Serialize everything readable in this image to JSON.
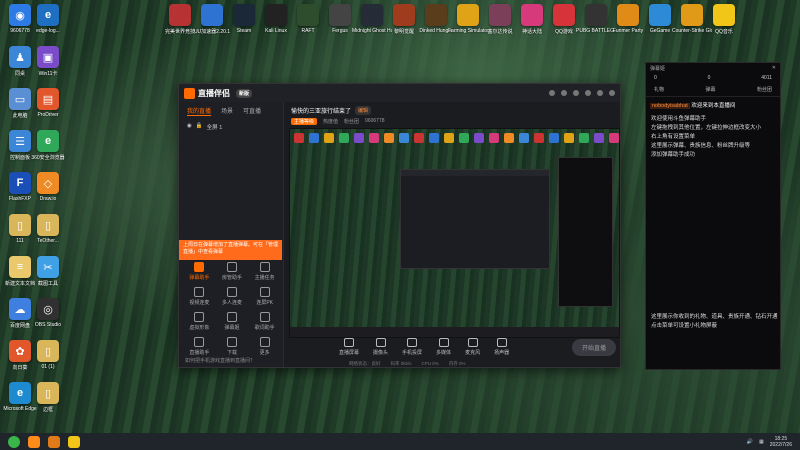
{
  "desktop_icons_left": [
    {
      "label": "9606778",
      "color": "#2c7be5",
      "glyph": "◉"
    },
    {
      "label": "edge-log...",
      "color": "#1e6fc1",
      "glyph": "e"
    },
    {
      "label": "同桌",
      "color": "#3b86d6",
      "glyph": "♟"
    },
    {
      "label": "Win11卡",
      "color": "#7a4cc9",
      "glyph": "▣"
    },
    {
      "label": "此电脑",
      "color": "#5a8fd4",
      "glyph": "▭"
    },
    {
      "label": "ProDriver",
      "color": "#e2562b",
      "glyph": "▤"
    },
    {
      "label": "控制面板",
      "color": "#3b86d6",
      "glyph": "☰"
    },
    {
      "label": "360安全浏览器",
      "color": "#2fa85a",
      "glyph": "e"
    },
    {
      "label": "FlashFXP",
      "color": "#1a4fb8",
      "glyph": "F"
    },
    {
      "label": "Draw.io",
      "color": "#f08a24",
      "glyph": "◇"
    },
    {
      "label": "111",
      "color": "#d9b65a",
      "glyph": "▯"
    },
    {
      "label": "TeOther...",
      "color": "#d9b65a",
      "glyph": "▯"
    },
    {
      "label": "新建文本文档",
      "color": "#e9c96b",
      "glyph": "≡"
    },
    {
      "label": "截图工具",
      "color": "#3fa0e6",
      "glyph": "✂"
    },
    {
      "label": "百度网盘",
      "color": "#3e7fe0",
      "glyph": "☁"
    },
    {
      "label": "OBS Studio",
      "color": "#303030",
      "glyph": "◎"
    },
    {
      "label": "向日葵",
      "color": "#e2562b",
      "glyph": "✿"
    },
    {
      "label": "01 (1)",
      "color": "#d9b65a",
      "glyph": "▯"
    },
    {
      "label": "Microsoft Edge",
      "color": "#1e8bd1",
      "glyph": "e"
    },
    {
      "label": "边框",
      "color": "#d9b65a",
      "glyph": "▯"
    }
  ],
  "desktop_icons_top": [
    {
      "label": "完美世界竞技",
      "color": "#b73333"
    },
    {
      "label": "UU加速器2.20.1",
      "color": "#2e72d2"
    },
    {
      "label": "Steam",
      "color": "#1b2838"
    },
    {
      "label": "Kali Linux",
      "color": "#222"
    },
    {
      "label": "RAFT",
      "color": "#2d4d2d"
    },
    {
      "label": "Fergus",
      "color": "#444"
    },
    {
      "label": "Midnight Ghost Hunt",
      "color": "#262b38"
    },
    {
      "label": "黎明觉醒",
      "color": "#a03c1e"
    },
    {
      "label": "Dinked Hunger",
      "color": "#5a3d1b"
    },
    {
      "label": "Farming Simulator",
      "color": "#e0a317"
    },
    {
      "label": "塞尔达传说",
      "color": "#7b3f5a"
    },
    {
      "label": "神话大陆",
      "color": "#d63a7a"
    },
    {
      "label": "QQ游戏",
      "color": "#d6343a"
    },
    {
      "label": "PUBG BATTLEG...",
      "color": "#333"
    },
    {
      "label": "Funmer Party",
      "color": "#e08a17"
    },
    {
      "label": "GeGame",
      "color": "#2d8ad6"
    },
    {
      "label": "Counter-Strike Global Of...",
      "color": "#e09a17"
    },
    {
      "label": "QQ音乐",
      "color": "#f2c618"
    }
  ],
  "app": {
    "name": "直播伴侣",
    "version": "新版",
    "left_tabs": [
      "我的直播",
      "场景",
      "可直播"
    ],
    "scene_label": "全屏 1",
    "notice": "上周日在弹幕增加了直播弹幕。可在「管理直播」中查看弹幕",
    "tools": [
      {
        "label": "弹幕助手",
        "hot": true
      },
      {
        "label": "房管助手",
        "hot": false
      },
      {
        "label": "主播任务",
        "hot": false
      },
      {
        "label": "视频连麦",
        "hot": false
      },
      {
        "label": "多人连麦",
        "hot": false
      },
      {
        "label": "连屏PK",
        "hot": false
      },
      {
        "label": "虚拟形象",
        "hot": false
      },
      {
        "label": "弹幕姬",
        "hot": false
      },
      {
        "label": "歌词助手",
        "hot": false
      },
      {
        "label": "直播助手",
        "hot": false
      },
      {
        "label": "下载",
        "hot": false
      },
      {
        "label": "更多",
        "hot": false
      }
    ],
    "left_footer": "如何把手机游戏直播到直播间？",
    "stream_title": "愉快的三亚旅行结束了",
    "edit_label": "编辑",
    "meta_tag": "主播等级",
    "meta": [
      "热度值",
      "粉丝团",
      "9606778"
    ],
    "controls": [
      "直播屏幕",
      "摄像头",
      "手机投屏",
      "多媒体",
      "麦克风",
      "扬声器"
    ],
    "start_button": "开始直播",
    "status": [
      "网络状态：良好",
      "码率 0kb/s",
      "CPU 0%",
      "内存 0%"
    ]
  },
  "danmaku": {
    "title": "弹幕姬",
    "close": "✕",
    "stats": [
      "0",
      "0",
      "4011"
    ],
    "tabs": [
      "礼物",
      "弹幕",
      "粉丝团"
    ],
    "nick": "nobodyisabhat",
    "welcome": "欢迎来到本直播间",
    "lines": [
      "欢迎使用斗鱼弹幕助手",
      "左键拖拽到其他位置，左键拉伸边框改变大小",
      "右上角有设置菜单",
      "这里展示弹幕、贵族信息、粉丝牌升级等",
      "添加弹幕助手成功"
    ],
    "lines2": [
      "这里展示你收到的礼物、道具、贵族开通、钻石开通",
      "点击菜单可设置小礼物屏蔽"
    ]
  },
  "taskbar": {
    "time": "18:25",
    "date": "2022/7/26"
  }
}
